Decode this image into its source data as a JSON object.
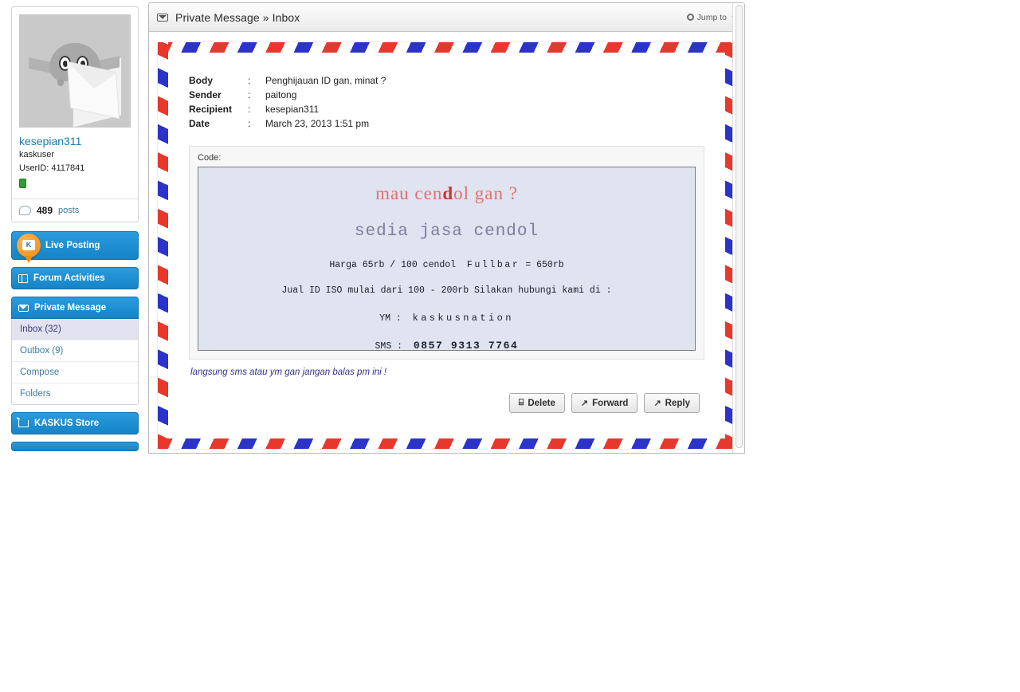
{
  "sidebar": {
    "profile": {
      "avatar_icon": "mascot-with-envelope-avatar",
      "username": "kesepian311",
      "usertitle": "kaskuser",
      "userid_label": "UserID: 4117841",
      "reputation_badge_icon": "green-cendol-badge",
      "posts_icon": "speech-bubble-icon",
      "posts_count": "489",
      "posts_word": "posts"
    },
    "nav": [
      {
        "label": "Live Posting",
        "icon": "kaskus-pin-icon",
        "type": "promo"
      },
      {
        "label": "Forum Activities",
        "icon": "grid-icon",
        "type": "section"
      },
      {
        "label": "Private Message",
        "icon": "envelope-icon",
        "type": "section",
        "expanded": true,
        "items": [
          {
            "label": "Inbox (32)",
            "active": true
          },
          {
            "label": "Outbox (9)",
            "active": false
          },
          {
            "label": "Compose",
            "active": false
          },
          {
            "label": "Folders",
            "active": false
          }
        ]
      },
      {
        "label": "KASKUS Store",
        "icon": "cart-icon",
        "type": "section"
      },
      {
        "label": "",
        "icon": "partial-icon",
        "type": "section-partial"
      }
    ]
  },
  "header": {
    "envelope_icon": "envelope-icon",
    "title": "Private Message » Inbox",
    "gear_icon": "gear-icon",
    "jump_to": "Jump to",
    "caret_icon": "chevron-down-icon"
  },
  "message": {
    "fields": [
      {
        "key": "Body",
        "sep": ":",
        "value": "Penghijauan ID gan, minat ?",
        "link": false
      },
      {
        "key": "Sender",
        "sep": ":",
        "value": "paitong",
        "link": true
      },
      {
        "key": "Recipient",
        "sep": ":",
        "value": "kesepian311",
        "link": true
      },
      {
        "key": "Date",
        "sep": ":",
        "value": "March 23, 2013 1:51 pm",
        "link": false
      }
    ],
    "code_label": "Code:",
    "code_lines": {
      "l1_a": "mau cen",
      "l1_b": "d",
      "l1_c": "ol gan ?",
      "l2": "sedia jasa cendol",
      "l3_a": "Harga 65rb / 100 cendol",
      "l3_b": "Fullbar",
      "l3_c": "= 650rb",
      "l4": "Jual ID ISO mulai dari 100 - 200rb   Silakan hubungi kami di :",
      "l5_a": "YM :",
      "l5_b": "kaskusnation",
      "l6_a": "SMS :",
      "l6_b": "0857 9313  7764"
    },
    "note": "langsung sms atau ym gan jangan balas pm ini !",
    "buttons": [
      {
        "label": "Delete",
        "icon": "trash-icon",
        "glyph": "⌸"
      },
      {
        "label": "Forward",
        "icon": "forward-icon",
        "glyph": "↗"
      },
      {
        "label": "Reply",
        "icon": "reply-icon",
        "glyph": "↗"
      }
    ]
  },
  "colors": {
    "accent_blue": "#1684c7",
    "link_blue": "#3b7d9c",
    "stripe_red": "#e8372c",
    "stripe_blue": "#2b33c9",
    "code_bg": "#e0e3f0",
    "code_red": "#e2706d",
    "code_slate": "#7b7f9e",
    "note_blue": "#32328c",
    "badge_green": "#2f9e2f"
  }
}
